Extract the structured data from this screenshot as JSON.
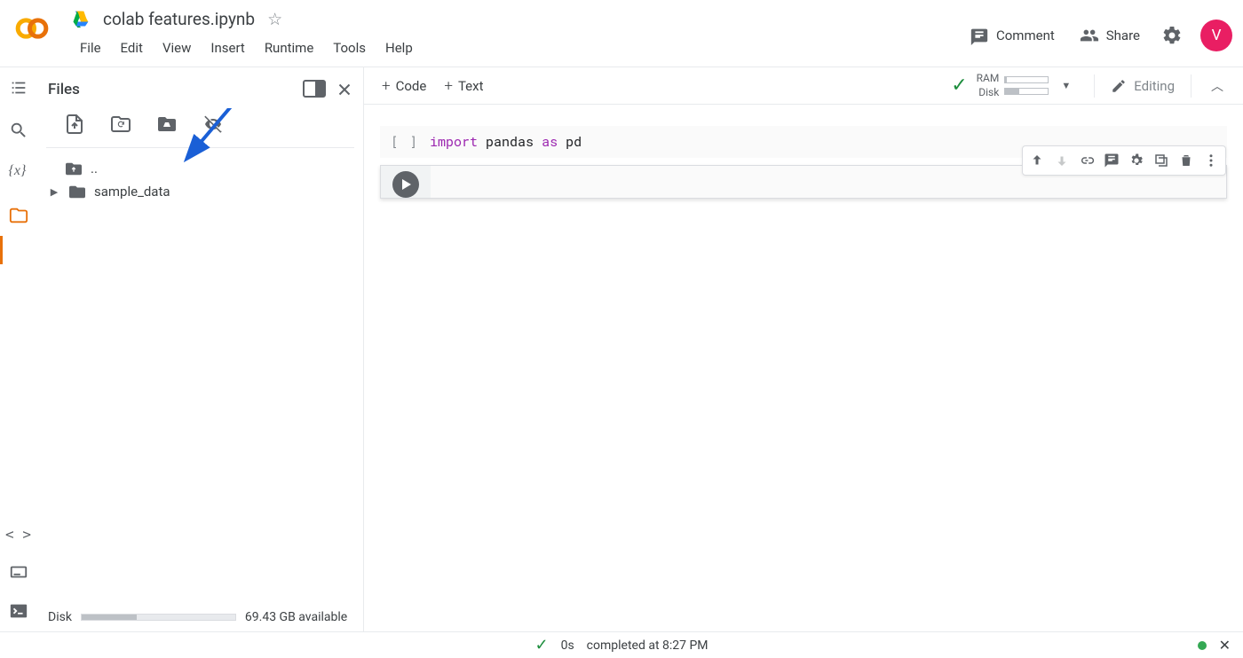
{
  "header": {
    "doc_title": "colab features.ipynb",
    "comment": "Comment",
    "share": "Share",
    "avatar_initial": "V"
  },
  "menubar": [
    "File",
    "Edit",
    "View",
    "Insert",
    "Runtime",
    "Tools",
    "Help"
  ],
  "toolbar": {
    "code": "Code",
    "text": "Text",
    "ram": "RAM",
    "disk": "Disk",
    "editing": "Editing"
  },
  "files_panel": {
    "title": "Files",
    "parent": "..",
    "sample_folder": "sample_data",
    "disk_label": "Disk",
    "disk_avail": "69.43 GB available"
  },
  "cells": {
    "c1": {
      "import_kw": "import",
      "module": "pandas",
      "as_kw": "as",
      "alias": "pd"
    }
  },
  "statusbar": {
    "duration": "0s",
    "completed": "completed at 8:27 PM"
  },
  "resources": {
    "ram_pct": 4,
    "disk_pct": 32
  },
  "disk_usage_pct": 36
}
